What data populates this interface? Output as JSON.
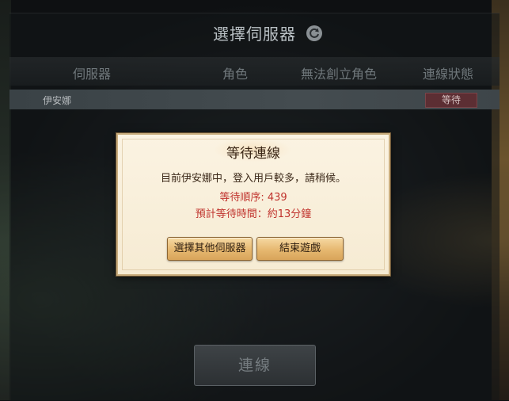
{
  "page": {
    "title": "選擇伺服器"
  },
  "table": {
    "headers": {
      "server": "伺服器",
      "character": "角色",
      "cannot_create": "無法創立角色",
      "status": "連線狀態"
    },
    "rows": [
      {
        "server": "伊安娜",
        "status": "等待"
      }
    ]
  },
  "dialog": {
    "title": "等待連線",
    "message": "目前伊安娜中，登入用戶較多，請稍候。",
    "queue": "等待順序: 439",
    "wait_time": "預計等待時間：約13分鐘",
    "buttons": {
      "other_server": "選擇其他伺服器",
      "end_game": "結束遊戲"
    }
  },
  "footer": {
    "connect_label": "連線"
  },
  "icons": {
    "refresh": "refresh-icon"
  },
  "colors": {
    "status_badge": "#5c2e33",
    "highlight_text": "#c0332d",
    "dialog_button": "#e6b870"
  }
}
